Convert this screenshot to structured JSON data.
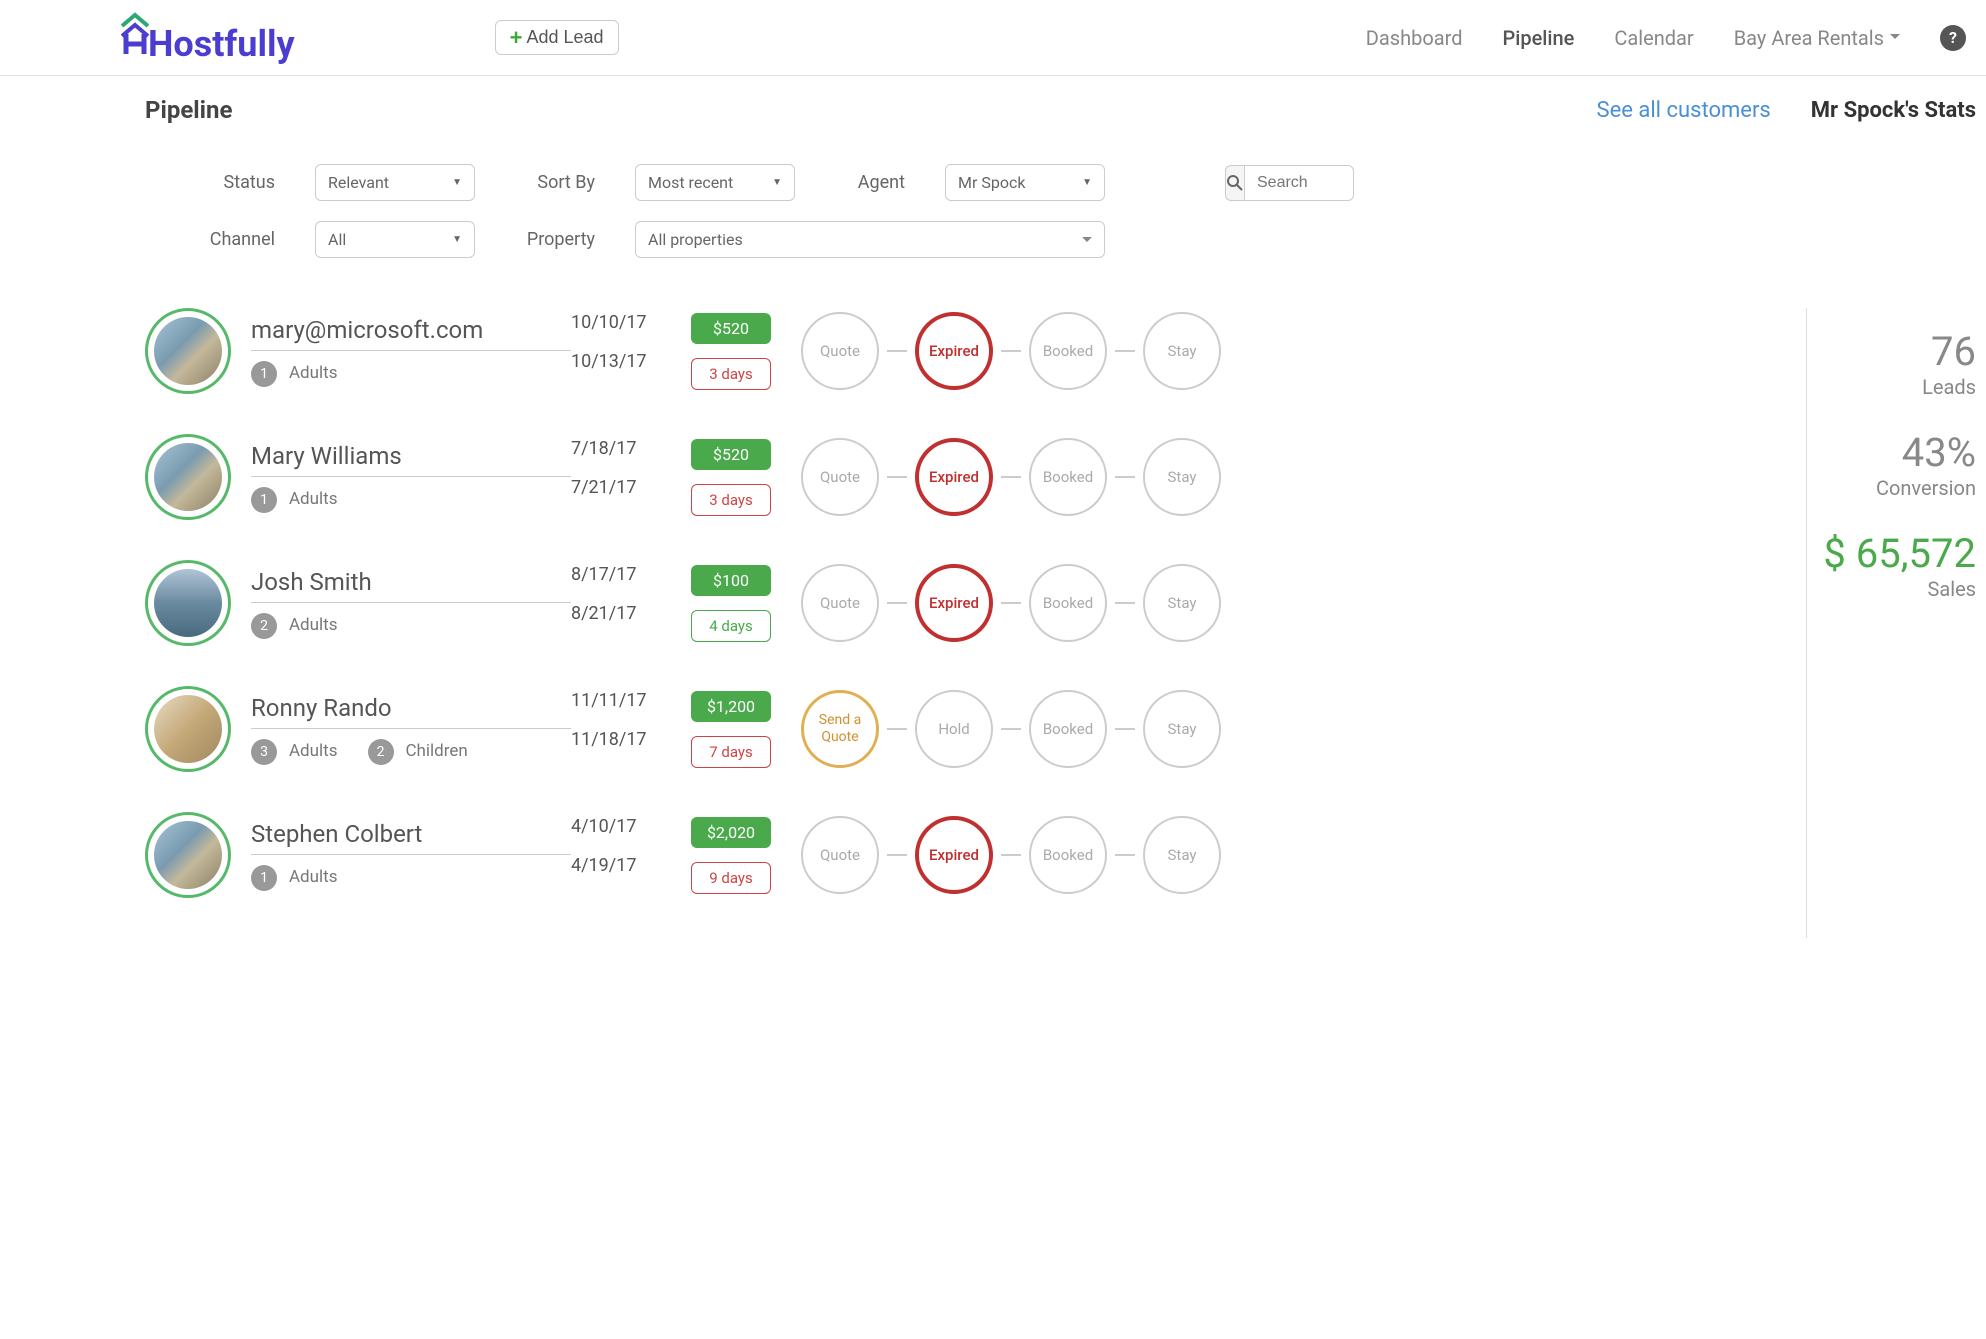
{
  "header": {
    "logo_text": "Hostfully",
    "add_lead": "Add Lead",
    "nav": {
      "dashboard": "Dashboard",
      "pipeline": "Pipeline",
      "calendar": "Calendar",
      "account": "Bay Area Rentals"
    }
  },
  "subhead": {
    "title": "Pipeline",
    "see_all": "See all customers",
    "stats_link": "Mr Spock's Stats"
  },
  "filters": {
    "status_label": "Status",
    "status_value": "Relevant",
    "sortby_label": "Sort By",
    "sortby_value": "Most recent",
    "agent_label": "Agent",
    "agent_value": "Mr Spock",
    "channel_label": "Channel",
    "channel_value": "All",
    "property_label": "Property",
    "property_value": "All properties",
    "search_placeholder": "Search"
  },
  "stage_labels": {
    "quote": "Quote",
    "send_quote": "Send a Quote",
    "expired": "Expired",
    "hold": "Hold",
    "booked": "Booked",
    "stay": "Stay"
  },
  "guest_labels": {
    "adults": "Adults",
    "children": "Children"
  },
  "leads": [
    {
      "name": "mary@microsoft.com",
      "adults": "1",
      "children": null,
      "date1": "10/10/17",
      "date2": "10/13/17",
      "price": "$520",
      "days": "3 days",
      "days_style": "red",
      "stage1": "quote",
      "stage2": "expired",
      "stage2_style": "active-red",
      "avatar": "house",
      "ring": "green"
    },
    {
      "name": "Mary Williams",
      "adults": "1",
      "children": null,
      "date1": "7/18/17",
      "date2": "7/21/17",
      "price": "$520",
      "days": "3 days",
      "days_style": "red",
      "stage1": "quote",
      "stage2": "expired",
      "stage2_style": "active-red",
      "avatar": "house",
      "ring": "green"
    },
    {
      "name": "Josh Smith",
      "adults": "2",
      "children": null,
      "date1": "8/17/17",
      "date2": "8/21/17",
      "price": "$100",
      "days": "4 days",
      "days_style": "green",
      "stage1": "quote",
      "stage2": "expired",
      "stage2_style": "active-red",
      "avatar": "city",
      "ring": "green"
    },
    {
      "name": "Ronny Rando",
      "adults": "3",
      "children": "2",
      "date1": "11/11/17",
      "date2": "11/18/17",
      "price": "$1,200",
      "days": "7 days",
      "days_style": "red",
      "stage1": "send_quote",
      "stage1_style": "active-yellow",
      "stage2": "hold",
      "stage2_style": "",
      "avatar": "interior",
      "ring": "green"
    },
    {
      "name": "Stephen Colbert",
      "adults": "1",
      "children": null,
      "date1": "4/10/17",
      "date2": "4/19/17",
      "price": "$2,020",
      "days": "9 days",
      "days_style": "red",
      "stage1": "quote",
      "stage2": "expired",
      "stage2_style": "active-red",
      "avatar": "house",
      "ring": "green"
    }
  ],
  "stats": {
    "leads_num": "76",
    "leads_label": "Leads",
    "conv_num": "43%",
    "conv_label": "Conversion",
    "sales_num": "$ 65,572",
    "sales_label": "Sales"
  }
}
